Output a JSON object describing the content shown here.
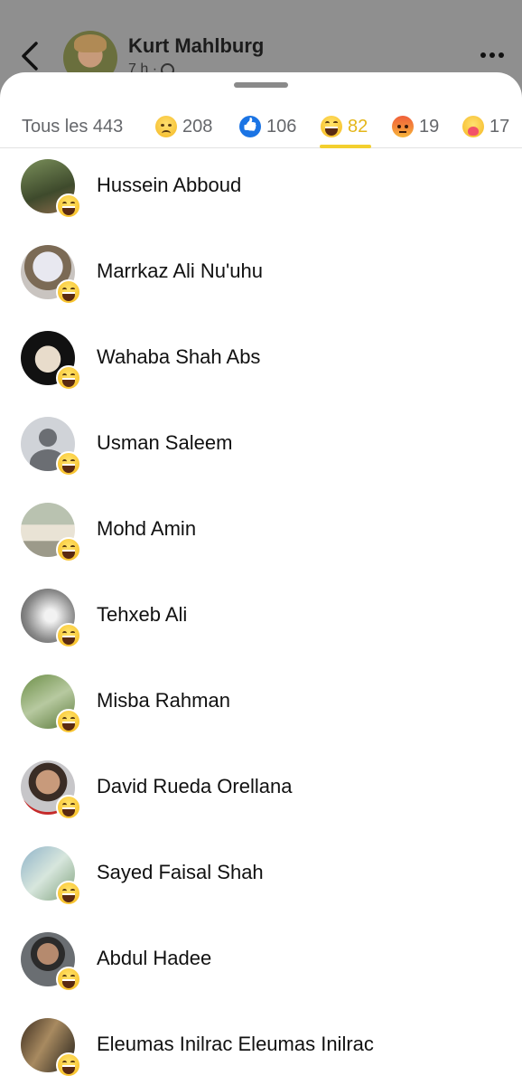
{
  "post": {
    "author": "Kurt Mahlburg",
    "time": "7 h ·"
  },
  "tabs": [
    {
      "label": "Tous les 443",
      "reaction": "all"
    },
    {
      "label": "208",
      "reaction": "sad-icon"
    },
    {
      "label": "106",
      "reaction": "like-icon"
    },
    {
      "label": "82",
      "reaction": "haha-icon",
      "active": true
    },
    {
      "label": "19",
      "reaction": "angry-icon"
    },
    {
      "label": "17",
      "reaction": "care-icon"
    }
  ],
  "colors": {
    "active_tab": "#e4b61a",
    "active_underline": "#f3cf2e",
    "like_blue": "#1b74e4"
  },
  "people": [
    {
      "name": "Hussein Abboud"
    },
    {
      "name": "Marrkaz Ali Nu'uhu"
    },
    {
      "name": "Wahaba Shah Abs"
    },
    {
      "name": "Usman Saleem"
    },
    {
      "name": "Mohd Amin"
    },
    {
      "name": "Tehxeb Ali"
    },
    {
      "name": "Misba Rahman"
    },
    {
      "name": "David Rueda Orellana"
    },
    {
      "name": "Sayed Faisal Shah"
    },
    {
      "name": "Abdul Hadee"
    },
    {
      "name": "Eleumas Inilrac Eleumas Inilrac"
    }
  ]
}
